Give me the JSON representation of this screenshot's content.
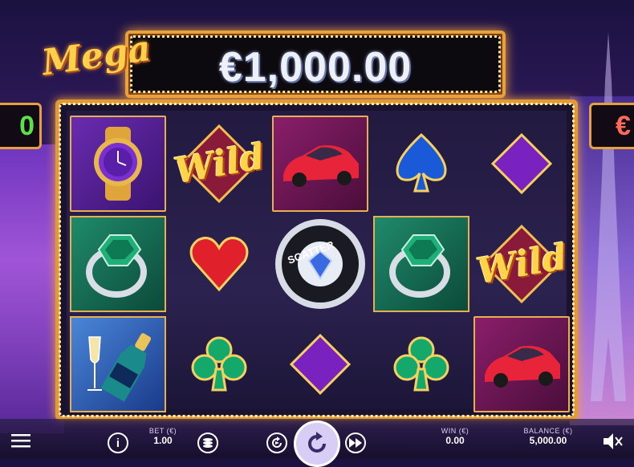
{
  "jackpot": {
    "label": "Mega",
    "amount": "€1,000.00"
  },
  "side_jackpots": {
    "left": "0",
    "right": "€"
  },
  "reels": {
    "symbols": [
      [
        "watch",
        "champagne-ring-placeholder"
      ],
      [
        "wild",
        "heart",
        "club"
      ],
      [
        "car",
        "scatter",
        "diamond"
      ],
      [
        "spade",
        "ring",
        "club"
      ],
      [
        "diamond",
        "wild",
        "car"
      ]
    ],
    "wild_label": "Wild",
    "scatter_label": "SCATTER"
  },
  "controls": {
    "bet_label": "BET (€)",
    "bet_value": "1.00",
    "win_label": "WIN (€)",
    "win_value": "0.00",
    "balance_label": "BALANCE (€)",
    "balance_value": "5,000.00"
  },
  "colors": {
    "frame": "#e39a36",
    "accent": "#ffd04a",
    "bar": "#1c1436"
  }
}
